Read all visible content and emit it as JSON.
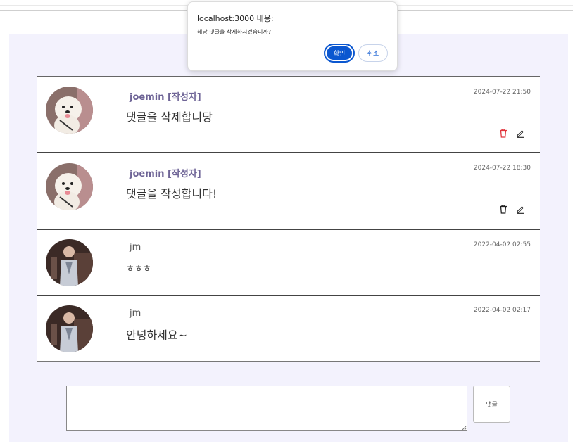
{
  "dialog": {
    "title": "localhost:3000 내용:",
    "message": "해당 댓글을 삭제하시겠습니까?",
    "ok_label": "확인",
    "cancel_label": "취소"
  },
  "comments": [
    {
      "author": "joemin [작성자]",
      "text": "댓글을 삭제합니당",
      "date": "2024-07-22 21:50",
      "avatar": "dog-avatar",
      "is_author": true,
      "delete_color": "#e0343c"
    },
    {
      "author": "joemin [작성자]",
      "text": "댓글을 작성합니다!",
      "date": "2024-07-22 18:30",
      "avatar": "dog-avatar",
      "is_author": true,
      "delete_color": "#222222"
    },
    {
      "author": "jm",
      "text": "ㅎㅎㅎ",
      "date": "2022-04-02 02:55",
      "avatar": "person-avatar",
      "is_author": false
    },
    {
      "author": "jm",
      "text": "안녕하세요~",
      "date": "2022-04-02 02:17",
      "avatar": "person-avatar",
      "is_author": false
    }
  ],
  "comment_form": {
    "input_value": "",
    "submit_label": "댓글"
  },
  "colors": {
    "panel_bg": "#f3f2fd",
    "author_color": "#6e6496",
    "dialog_primary": "#0b57d0"
  }
}
